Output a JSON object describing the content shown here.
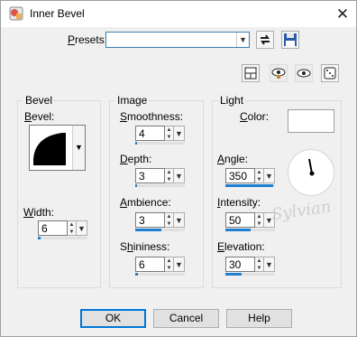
{
  "window": {
    "title": "Inner Bevel",
    "close_icon": "close-icon"
  },
  "presets": {
    "label": "Presets:",
    "value": ""
  },
  "bevel_group": {
    "title": "Bevel",
    "bevel_label": "Bevel:",
    "width_label": "Width:",
    "width": {
      "value": "6",
      "level": 0.06
    }
  },
  "image_group": {
    "title": "Image",
    "smoothness": {
      "label": "Smoothness:",
      "value": "4",
      "level": 0.04
    },
    "depth": {
      "label": "Depth:",
      "value": "3",
      "level": 0.03
    },
    "ambience": {
      "label": "Ambience:",
      "value": "3",
      "level": 0.53
    },
    "shininess": {
      "label": "Shininess:",
      "value": "6",
      "level": 0.06
    }
  },
  "light_group": {
    "title": "Light",
    "color_label": "Color:",
    "color": "#ffffff",
    "angle": {
      "label": "Angle:",
      "value": "350",
      "level": 0.97
    },
    "intensity": {
      "label": "Intensity:",
      "value": "50",
      "level": 0.5
    },
    "elevation": {
      "label": "Elevation:",
      "value": "30",
      "level": 0.33
    }
  },
  "watermark": "Sylvian",
  "buttons": {
    "ok": "OK",
    "cancel": "Cancel",
    "help": "Help"
  },
  "colors": {
    "accent": "#1e7fd2",
    "focus": "#0078d7"
  }
}
